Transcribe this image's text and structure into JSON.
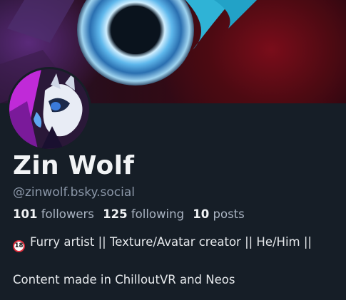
{
  "profile": {
    "display_name": "Zin Wolf",
    "handle": "@zinwolf.bsky.social",
    "stats": {
      "followers_count": "101",
      "followers_label": "followers",
      "following_count": "125",
      "following_label": "following",
      "posts_count": "10",
      "posts_label": "posts"
    },
    "bio": {
      "badge": "18",
      "line1": "Furry artist || Texture/Avatar creator || He/Him ||",
      "line2": "Content made in ChilloutVR and Neos"
    }
  },
  "colors": {
    "background": "#161e27",
    "text_primary": "#f1f3f5",
    "text_secondary": "#8b97a8",
    "age_badge_ring": "#d92b3a"
  }
}
